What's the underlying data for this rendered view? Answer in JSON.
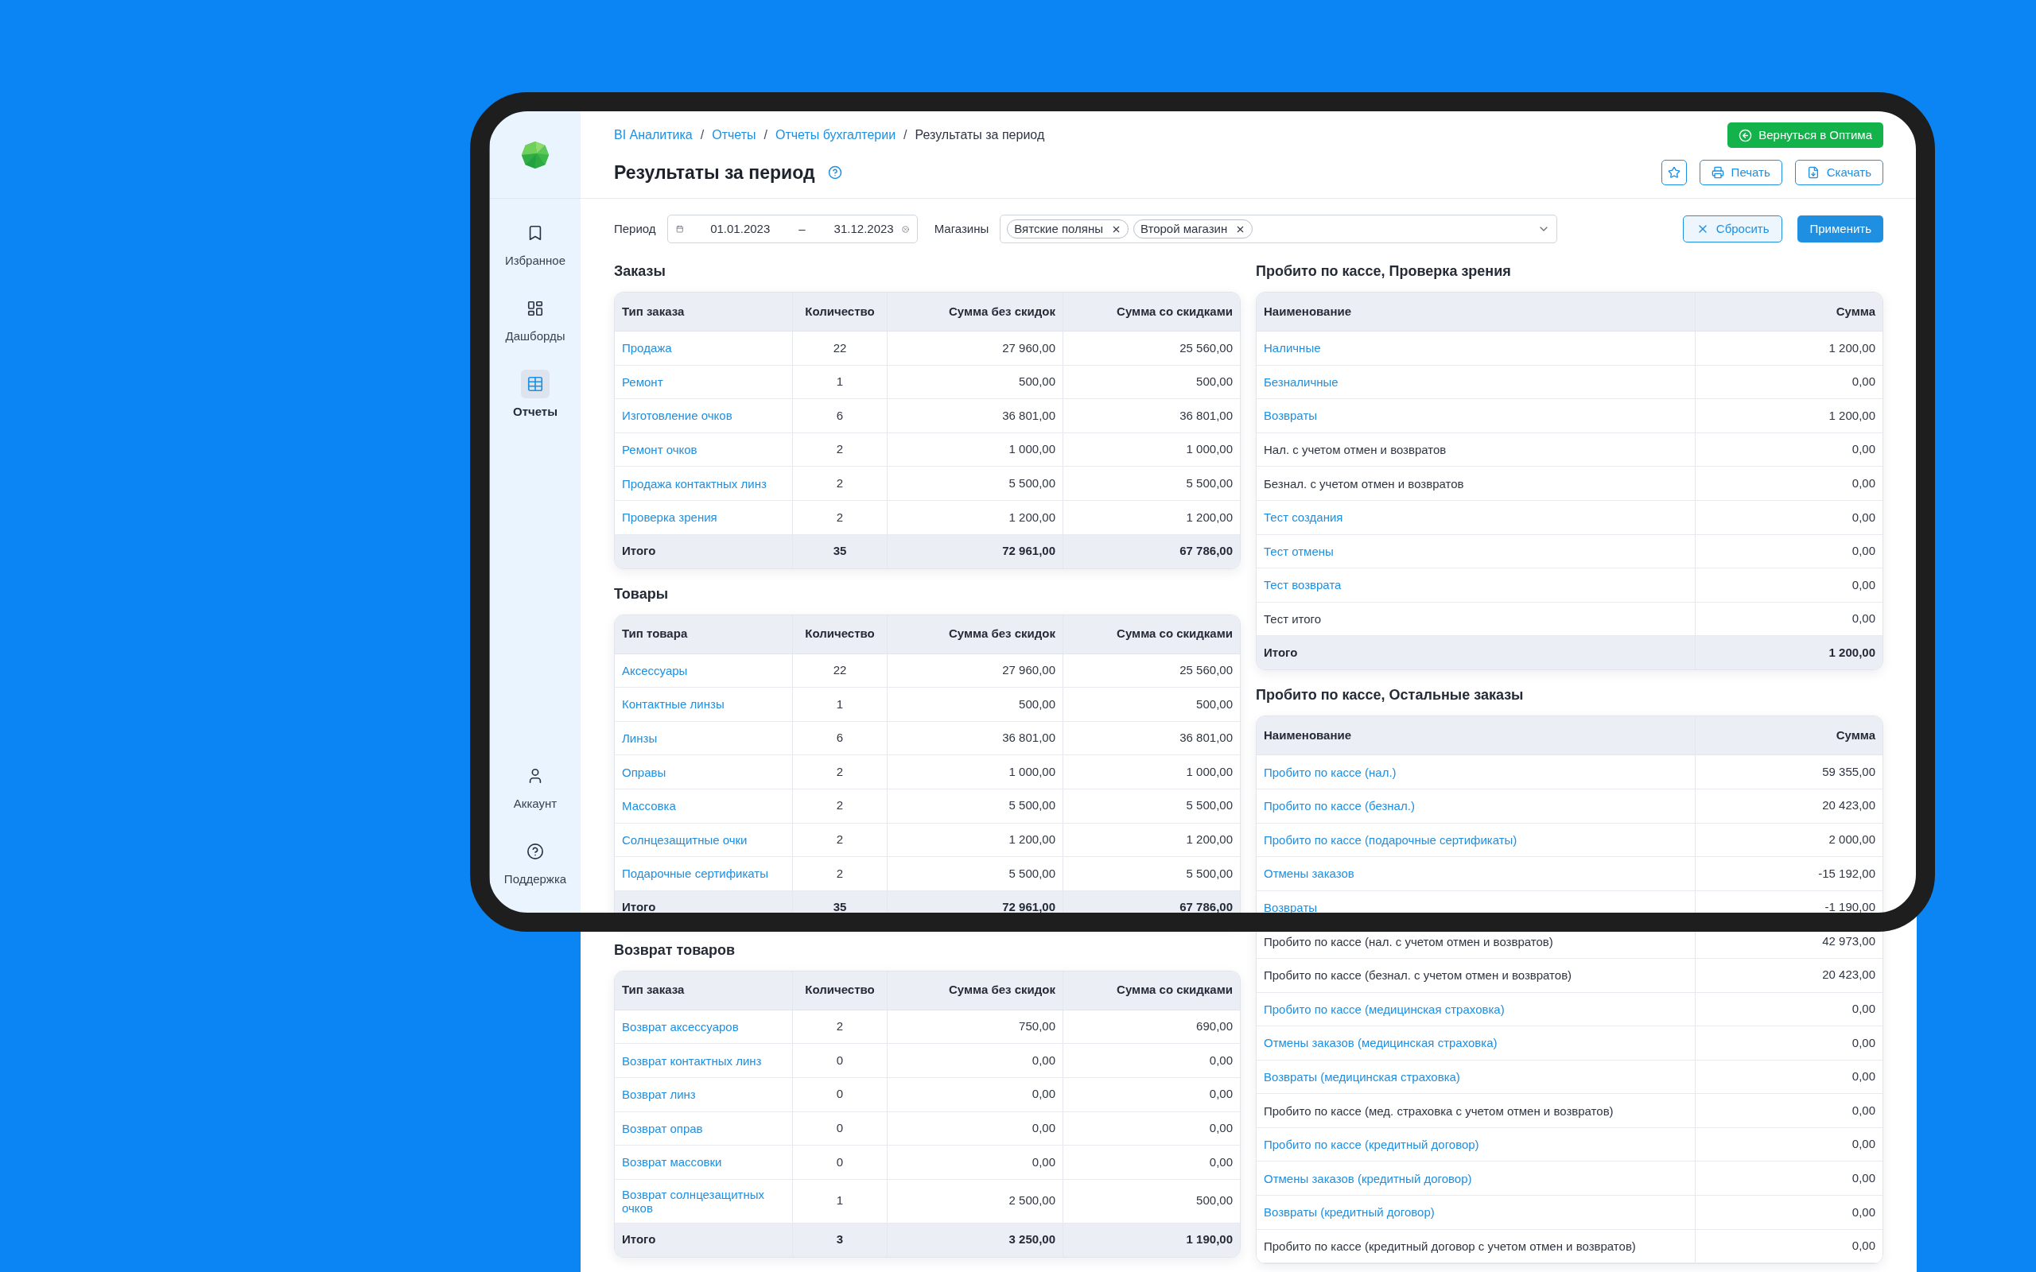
{
  "sidebar": {
    "items": [
      {
        "kind": "favorites",
        "label": "Избранное",
        "selected": false
      },
      {
        "kind": "dashboards",
        "label": "Дашборды",
        "selected": false
      },
      {
        "kind": "reports",
        "label": "Отчеты",
        "selected": true
      }
    ],
    "bottom_items": [
      {
        "kind": "account",
        "label": "Аккаунт",
        "selected": false
      },
      {
        "kind": "support",
        "label": "Поддержка",
        "selected": false
      }
    ]
  },
  "breadcrumb": [
    {
      "label": "BI Аналитика",
      "link": true
    },
    {
      "label": "Отчеты",
      "link": true
    },
    {
      "label": "Отчеты бухгалтерии",
      "link": true
    },
    {
      "label": "Результаты за период",
      "link": false
    }
  ],
  "breadcrumb_separator": "/",
  "title": "Результаты за период",
  "return_button": "Вернуться в Оптима",
  "actions": {
    "print": "Печать",
    "download": "Скачать"
  },
  "filters": {
    "period_label": "Период",
    "date_from": "01.01.2023",
    "date_separator": "–",
    "date_to": "31.12.2023",
    "stores_label": "Магазины",
    "stores": [
      "Вятские поляны",
      "Второй магазин"
    ],
    "reset": "Сбросить",
    "apply": "Применить"
  },
  "left_sections": [
    {
      "title": "Заказы",
      "columns": [
        "Тип заказа",
        "Количество",
        "Сумма без скидок",
        "Сумма со скидками"
      ],
      "rows": [
        {
          "link": true,
          "cells": [
            "Продажа",
            "22",
            "27 960,00",
            "25 560,00"
          ]
        },
        {
          "link": true,
          "cells": [
            "Ремонт",
            "1",
            "500,00",
            "500,00"
          ]
        },
        {
          "link": true,
          "cells": [
            "Изготовление очков",
            "6",
            "36 801,00",
            "36 801,00"
          ]
        },
        {
          "link": true,
          "cells": [
            "Ремонт очков",
            "2",
            "1 000,00",
            "1 000,00"
          ]
        },
        {
          "link": true,
          "cells": [
            "Продажа контактных линз",
            "2",
            "5 500,00",
            "5 500,00"
          ]
        },
        {
          "link": true,
          "cells": [
            "Проверка зрения",
            "2",
            "1 200,00",
            "1 200,00"
          ]
        }
      ],
      "total": [
        "Итого",
        "35",
        "72 961,00",
        "67 786,00"
      ]
    },
    {
      "title": "Товары",
      "columns": [
        "Тип товара",
        "Количество",
        "Сумма без скидок",
        "Сумма со скидками"
      ],
      "rows": [
        {
          "link": true,
          "cells": [
            "Аксессуары",
            "22",
            "27 960,00",
            "25 560,00"
          ]
        },
        {
          "link": true,
          "cells": [
            "Контактные линзы",
            "1",
            "500,00",
            "500,00"
          ]
        },
        {
          "link": true,
          "cells": [
            "Линзы",
            "6",
            "36 801,00",
            "36 801,00"
          ]
        },
        {
          "link": true,
          "cells": [
            "Оправы",
            "2",
            "1 000,00",
            "1 000,00"
          ]
        },
        {
          "link": true,
          "cells": [
            "Массовка",
            "2",
            "5 500,00",
            "5 500,00"
          ]
        },
        {
          "link": true,
          "cells": [
            "Солнцезащитные очки",
            "2",
            "1 200,00",
            "1 200,00"
          ]
        },
        {
          "link": true,
          "cells": [
            "Подарочные сертификаты",
            "2",
            "5 500,00",
            "5 500,00"
          ]
        }
      ],
      "total": [
        "Итого",
        "35",
        "72 961,00",
        "67 786,00"
      ]
    },
    {
      "title": "Возврат товаров",
      "columns": [
        "Тип заказа",
        "Количество",
        "Сумма без скидок",
        "Сумма со скидками"
      ],
      "rows": [
        {
          "link": true,
          "cells": [
            "Возврат аксессуаров",
            "2",
            "750,00",
            "690,00"
          ]
        },
        {
          "link": true,
          "cells": [
            "Возврат контактных линз",
            "0",
            "0,00",
            "0,00"
          ]
        },
        {
          "link": true,
          "cells": [
            "Возврат линз",
            "0",
            "0,00",
            "0,00"
          ]
        },
        {
          "link": true,
          "cells": [
            "Возврат оправ",
            "0",
            "0,00",
            "0,00"
          ]
        },
        {
          "link": true,
          "cells": [
            "Возврат массовки",
            "0",
            "0,00",
            "0,00"
          ]
        },
        {
          "link": true,
          "cells": [
            "Возврат солнцезащитных очков",
            "1",
            "2 500,00",
            "500,00"
          ]
        }
      ],
      "total": [
        "Итого",
        "3",
        "3 250,00",
        "1 190,00"
      ]
    }
  ],
  "right_sections": [
    {
      "title": "Пробито по кассе, Проверка зрения",
      "columns": [
        "Наименование",
        "Сумма"
      ],
      "rows": [
        {
          "link": true,
          "cells": [
            "Наличные",
            "1 200,00"
          ]
        },
        {
          "link": true,
          "cells": [
            "Безналичные",
            "0,00"
          ]
        },
        {
          "link": true,
          "cells": [
            "Возвраты",
            "1 200,00"
          ]
        },
        {
          "link": false,
          "cells": [
            "Нал. с учетом отмен и возвратов",
            "0,00"
          ]
        },
        {
          "link": false,
          "cells": [
            "Безнал. с учетом отмен и возвратов",
            "0,00"
          ]
        },
        {
          "link": true,
          "cells": [
            "Тест создания",
            "0,00"
          ]
        },
        {
          "link": true,
          "cells": [
            "Тест отмены",
            "0,00"
          ]
        },
        {
          "link": true,
          "cells": [
            "Тест возврата",
            "0,00"
          ]
        },
        {
          "link": false,
          "cells": [
            "Тест итого",
            "0,00"
          ]
        }
      ],
      "total": [
        "Итого",
        "1 200,00"
      ]
    },
    {
      "title": "Пробито по кассе, Остальные заказы",
      "columns": [
        "Наименование",
        "Сумма"
      ],
      "rows": [
        {
          "link": true,
          "cells": [
            "Пробито по кассе (нал.)",
            "59 355,00"
          ]
        },
        {
          "link": true,
          "cells": [
            "Пробито по кассе (безнал.)",
            "20 423,00"
          ]
        },
        {
          "link": true,
          "cells": [
            "Пробито по кассе (подарочные сертификаты)",
            "2 000,00"
          ]
        },
        {
          "link": true,
          "cells": [
            "Отмены заказов",
            "-15 192,00"
          ]
        },
        {
          "link": true,
          "cells": [
            "Возвраты",
            "-1 190,00"
          ]
        },
        {
          "link": false,
          "cells": [
            "Пробито по кассе (нал. с учетом отмен и возвратов)",
            "42 973,00"
          ]
        },
        {
          "link": false,
          "cells": [
            "Пробито по кассе (безнал. с учетом отмен и возвратов)",
            "20 423,00"
          ]
        },
        {
          "link": true,
          "cells": [
            "Пробито по кассе (медицинская страховка)",
            "0,00"
          ]
        },
        {
          "link": true,
          "cells": [
            "Отмены заказов (медицинская страховка)",
            "0,00"
          ]
        },
        {
          "link": true,
          "cells": [
            "Возвраты (медицинская страховка)",
            "0,00"
          ]
        },
        {
          "link": false,
          "cells": [
            "Пробито по кассе (мед. страховка с учетом отмен и возвратов)",
            "0,00"
          ]
        },
        {
          "link": true,
          "cells": [
            "Пробито по кассе (кредитный договор)",
            "0,00"
          ]
        },
        {
          "link": true,
          "cells": [
            "Отмены заказов (кредитный договор)",
            "0,00"
          ]
        },
        {
          "link": true,
          "cells": [
            "Возвраты (кредитный договор)",
            "0,00"
          ]
        },
        {
          "link": false,
          "cells": [
            "Пробито по кассе (кредитный договор с учетом отмен и возвратов)",
            "0,00"
          ]
        }
      ]
    }
  ]
}
